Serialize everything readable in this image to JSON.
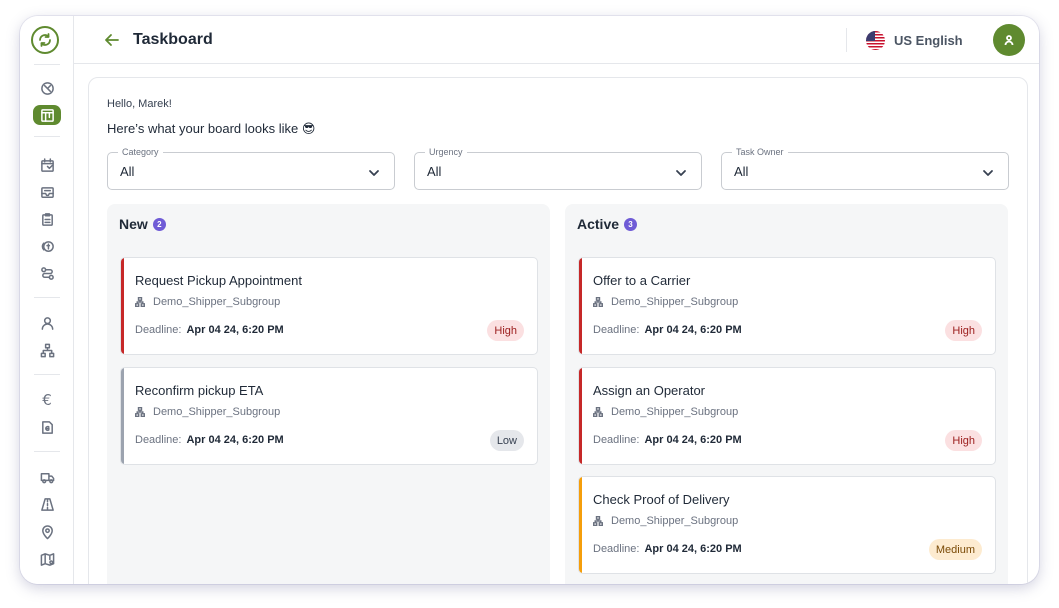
{
  "header": {
    "title": "Taskboard",
    "language": "US English"
  },
  "main": {
    "greeting": "Hello, Marek!",
    "subtitle": "Here’s what your board looks like 😎",
    "filters": [
      {
        "label": "Category",
        "value": "All"
      },
      {
        "label": "Urgency",
        "value": "All"
      },
      {
        "label": "Task Owner",
        "value": "All"
      }
    ],
    "columns": [
      {
        "title": "New",
        "count": "2",
        "cards": [
          {
            "title": "Request Pickup Appointment",
            "group": "Demo_Shipper_Subgroup",
            "deadline_label": "Deadline:",
            "deadline": "Apr 04 24, 6:20 PM",
            "urgency": "High"
          },
          {
            "title": "Reconfirm pickup ETA",
            "group": "Demo_Shipper_Subgroup",
            "deadline_label": "Deadline:",
            "deadline": "Apr 04 24, 6:20 PM",
            "urgency": "Low"
          }
        ]
      },
      {
        "title": "Active",
        "count": "3",
        "cards": [
          {
            "title": "Offer to a Carrier",
            "group": "Demo_Shipper_Subgroup",
            "deadline_label": "Deadline:",
            "deadline": "Apr 04 24, 6:20 PM",
            "urgency": "High"
          },
          {
            "title": "Assign an Operator",
            "group": "Demo_Shipper_Subgroup",
            "deadline_label": "Deadline:",
            "deadline": "Apr 04 24, 6:20 PM",
            "urgency": "High"
          },
          {
            "title": "Check Proof of Delivery",
            "group": "Demo_Shipper_Subgroup",
            "deadline_label": "Deadline:",
            "deadline": "Apr 04 24, 6:20 PM",
            "urgency": "Medium"
          }
        ]
      }
    ]
  },
  "sidebar": {
    "icons": [
      "dashboard-icon",
      "taskboard-icon",
      "calendar-icon",
      "inbox-icon",
      "clipboard-icon",
      "coins-icon",
      "route-icon",
      "user-icon",
      "org-chart-icon",
      "euro-icon",
      "invoice-icon",
      "truck-icon",
      "road-icon",
      "location-pin-icon",
      "map-icon"
    ]
  },
  "colors": {
    "brand": "#5f8a2f",
    "count_badge": "#6f5bd6",
    "high_bar": "#c62828",
    "high_badge_bg": "#fbe0e1",
    "high_badge_text": "#9b1c1c",
    "low_bar": "#9ca3af",
    "low_badge_bg": "#e5e7eb",
    "low_badge_text": "#374151",
    "medium_bar": "#f59e0b",
    "medium_badge_bg": "#fdebd0",
    "medium_badge_text": "#7a4a06"
  }
}
